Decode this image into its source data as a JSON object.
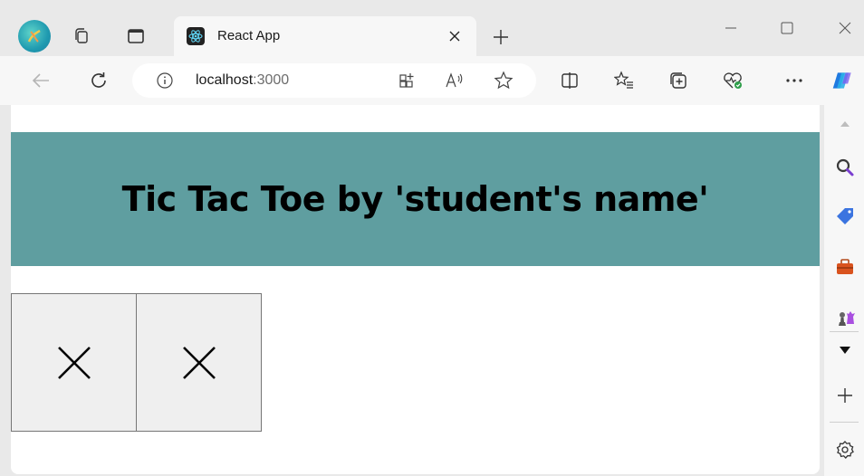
{
  "browser": {
    "tab": {
      "title": "React App"
    },
    "address": {
      "host": "localhost",
      "port": ":3000"
    },
    "colors": {
      "tabstrip": "#e9e9e9",
      "toolbar": "#f7f7f7",
      "header_bg": "#5f9ea0",
      "square_bg": "#efefef"
    },
    "icons": {
      "strip": [
        "profile-icon",
        "workspaces-icon",
        "tab-actions-icon"
      ],
      "toolbar": [
        "back-icon",
        "refresh-icon",
        "info-icon",
        "app-available-icon",
        "read-aloud-icon",
        "favorite-star-icon",
        "split-screen-icon",
        "favorites-icon",
        "collections-icon",
        "browser-essentials-icon",
        "more-icon",
        "copilot-icon"
      ],
      "sidebar": [
        "search-icon",
        "shopping-tag-icon",
        "tools-icon",
        "games-icon",
        "sidebar-expand-icon",
        "add-icon",
        "settings-icon"
      ]
    }
  },
  "app": {
    "title": "Tic Tac Toe by 'student's name'",
    "squares": [
      "X",
      "X"
    ]
  }
}
